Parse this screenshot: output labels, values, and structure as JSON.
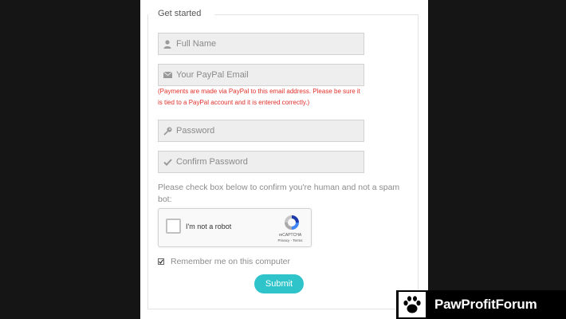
{
  "form": {
    "legend": "Get started",
    "fields": [
      {
        "placeholder": "Full Name",
        "icon": "user-icon"
      },
      {
        "placeholder": "Your PayPal Email",
        "icon": "envelope-icon"
      },
      {
        "placeholder": "Password",
        "icon": "key-icon"
      },
      {
        "placeholder": "Confirm Password",
        "icon": "checkmark-icon"
      }
    ],
    "paypal_warning": "(Payments are made via PayPal to this email address. Please be sure it is tied to a PayPal account and it is entered correctly.)",
    "human_check_text": "Please check box below to confirm you're human and not a spam bot:",
    "recaptcha": {
      "label": "I'm not a robot",
      "brand": "reCAPTCHA",
      "links": "Privacy - Terms"
    },
    "remember_label": "Remember me on this computer",
    "remember_checked": true,
    "submit_label": "Submit"
  },
  "watermark": {
    "text": "PawProfitForum",
    "icon": "paw-icon"
  },
  "colors": {
    "accent": "#2ec4c9",
    "warning": "#e0312b",
    "background": "#151515"
  }
}
